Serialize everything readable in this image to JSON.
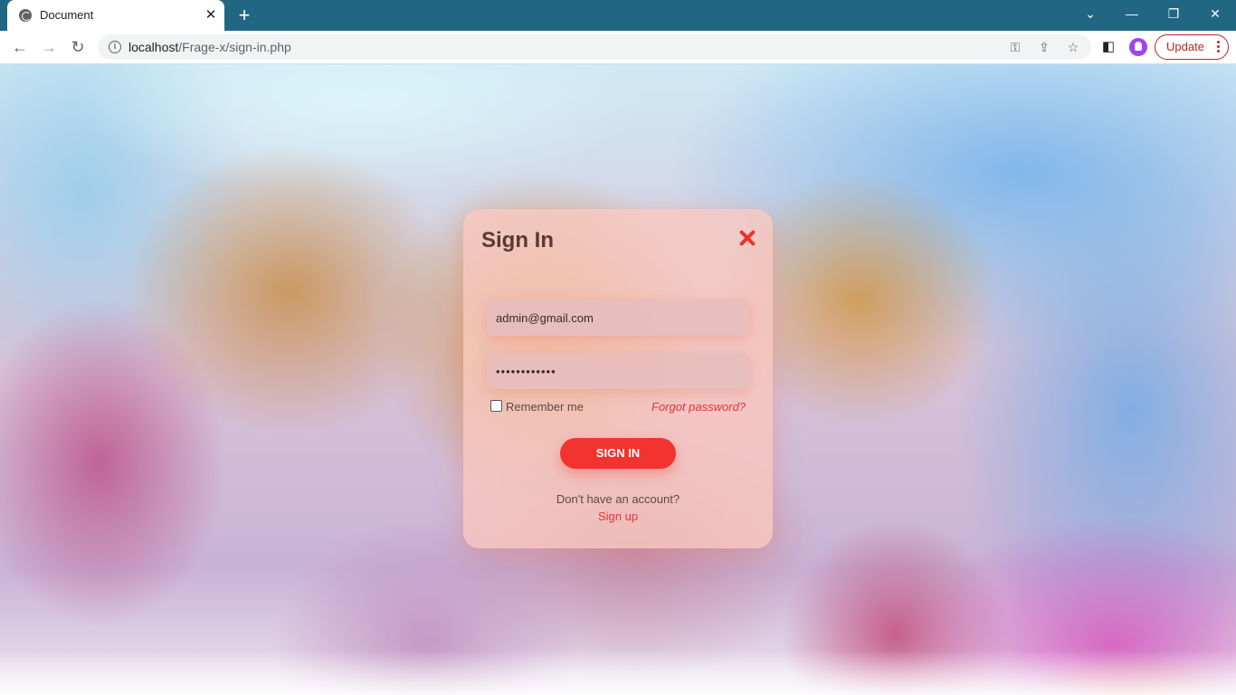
{
  "browser": {
    "tab": {
      "title": "Document",
      "close_glyph": "✕",
      "favicon": "globe-icon"
    },
    "new_tab_glyph": "+",
    "window_controls": {
      "tabsearch": "⌄",
      "minimize": "—",
      "restore": "❐",
      "close": "✕"
    },
    "nav": {
      "back": "←",
      "forward": "→",
      "reload": "↻"
    },
    "address": {
      "host": "localhost",
      "path": "/Frage-x/sign-in.php",
      "info_glyph": "i"
    },
    "omnibox_icons": {
      "key": "⚿",
      "share": "⇪",
      "star": "☆"
    },
    "toolbar_icons": {
      "side_panel": "◧"
    },
    "update_label": "Update"
  },
  "colors": {
    "tabstrip": "#216784",
    "accent_red": "#f23330",
    "modal_bg": "#fac8be"
  },
  "signin": {
    "title": "Sign In",
    "email_value": "admin@gmail.com",
    "password_value": "••••••••••••",
    "remember_label": "Remember me",
    "forgot_label": "Forgot password?",
    "button_label": "SIGN IN",
    "no_account_text": "Don't have an account?",
    "signup_label": "Sign up"
  }
}
